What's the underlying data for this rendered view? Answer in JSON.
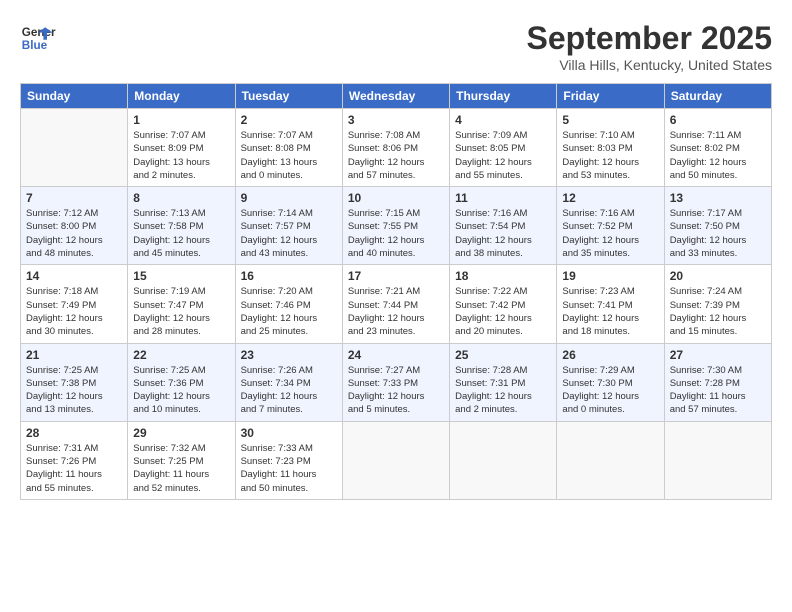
{
  "header": {
    "logo_line1": "General",
    "logo_line2": "Blue",
    "month_title": "September 2025",
    "subtitle": "Villa Hills, Kentucky, United States"
  },
  "days_of_week": [
    "Sunday",
    "Monday",
    "Tuesday",
    "Wednesday",
    "Thursday",
    "Friday",
    "Saturday"
  ],
  "weeks": [
    [
      {
        "day": "",
        "info": ""
      },
      {
        "day": "1",
        "info": "Sunrise: 7:07 AM\nSunset: 8:09 PM\nDaylight: 13 hours\nand 2 minutes."
      },
      {
        "day": "2",
        "info": "Sunrise: 7:07 AM\nSunset: 8:08 PM\nDaylight: 13 hours\nand 0 minutes."
      },
      {
        "day": "3",
        "info": "Sunrise: 7:08 AM\nSunset: 8:06 PM\nDaylight: 12 hours\nand 57 minutes."
      },
      {
        "day": "4",
        "info": "Sunrise: 7:09 AM\nSunset: 8:05 PM\nDaylight: 12 hours\nand 55 minutes."
      },
      {
        "day": "5",
        "info": "Sunrise: 7:10 AM\nSunset: 8:03 PM\nDaylight: 12 hours\nand 53 minutes."
      },
      {
        "day": "6",
        "info": "Sunrise: 7:11 AM\nSunset: 8:02 PM\nDaylight: 12 hours\nand 50 minutes."
      }
    ],
    [
      {
        "day": "7",
        "info": "Sunrise: 7:12 AM\nSunset: 8:00 PM\nDaylight: 12 hours\nand 48 minutes."
      },
      {
        "day": "8",
        "info": "Sunrise: 7:13 AM\nSunset: 7:58 PM\nDaylight: 12 hours\nand 45 minutes."
      },
      {
        "day": "9",
        "info": "Sunrise: 7:14 AM\nSunset: 7:57 PM\nDaylight: 12 hours\nand 43 minutes."
      },
      {
        "day": "10",
        "info": "Sunrise: 7:15 AM\nSunset: 7:55 PM\nDaylight: 12 hours\nand 40 minutes."
      },
      {
        "day": "11",
        "info": "Sunrise: 7:16 AM\nSunset: 7:54 PM\nDaylight: 12 hours\nand 38 minutes."
      },
      {
        "day": "12",
        "info": "Sunrise: 7:16 AM\nSunset: 7:52 PM\nDaylight: 12 hours\nand 35 minutes."
      },
      {
        "day": "13",
        "info": "Sunrise: 7:17 AM\nSunset: 7:50 PM\nDaylight: 12 hours\nand 33 minutes."
      }
    ],
    [
      {
        "day": "14",
        "info": "Sunrise: 7:18 AM\nSunset: 7:49 PM\nDaylight: 12 hours\nand 30 minutes."
      },
      {
        "day": "15",
        "info": "Sunrise: 7:19 AM\nSunset: 7:47 PM\nDaylight: 12 hours\nand 28 minutes."
      },
      {
        "day": "16",
        "info": "Sunrise: 7:20 AM\nSunset: 7:46 PM\nDaylight: 12 hours\nand 25 minutes."
      },
      {
        "day": "17",
        "info": "Sunrise: 7:21 AM\nSunset: 7:44 PM\nDaylight: 12 hours\nand 23 minutes."
      },
      {
        "day": "18",
        "info": "Sunrise: 7:22 AM\nSunset: 7:42 PM\nDaylight: 12 hours\nand 20 minutes."
      },
      {
        "day": "19",
        "info": "Sunrise: 7:23 AM\nSunset: 7:41 PM\nDaylight: 12 hours\nand 18 minutes."
      },
      {
        "day": "20",
        "info": "Sunrise: 7:24 AM\nSunset: 7:39 PM\nDaylight: 12 hours\nand 15 minutes."
      }
    ],
    [
      {
        "day": "21",
        "info": "Sunrise: 7:25 AM\nSunset: 7:38 PM\nDaylight: 12 hours\nand 13 minutes."
      },
      {
        "day": "22",
        "info": "Sunrise: 7:25 AM\nSunset: 7:36 PM\nDaylight: 12 hours\nand 10 minutes."
      },
      {
        "day": "23",
        "info": "Sunrise: 7:26 AM\nSunset: 7:34 PM\nDaylight: 12 hours\nand 7 minutes."
      },
      {
        "day": "24",
        "info": "Sunrise: 7:27 AM\nSunset: 7:33 PM\nDaylight: 12 hours\nand 5 minutes."
      },
      {
        "day": "25",
        "info": "Sunrise: 7:28 AM\nSunset: 7:31 PM\nDaylight: 12 hours\nand 2 minutes."
      },
      {
        "day": "26",
        "info": "Sunrise: 7:29 AM\nSunset: 7:30 PM\nDaylight: 12 hours\nand 0 minutes."
      },
      {
        "day": "27",
        "info": "Sunrise: 7:30 AM\nSunset: 7:28 PM\nDaylight: 11 hours\nand 57 minutes."
      }
    ],
    [
      {
        "day": "28",
        "info": "Sunrise: 7:31 AM\nSunset: 7:26 PM\nDaylight: 11 hours\nand 55 minutes."
      },
      {
        "day": "29",
        "info": "Sunrise: 7:32 AM\nSunset: 7:25 PM\nDaylight: 11 hours\nand 52 minutes."
      },
      {
        "day": "30",
        "info": "Sunrise: 7:33 AM\nSunset: 7:23 PM\nDaylight: 11 hours\nand 50 minutes."
      },
      {
        "day": "",
        "info": ""
      },
      {
        "day": "",
        "info": ""
      },
      {
        "day": "",
        "info": ""
      },
      {
        "day": "",
        "info": ""
      }
    ]
  ]
}
